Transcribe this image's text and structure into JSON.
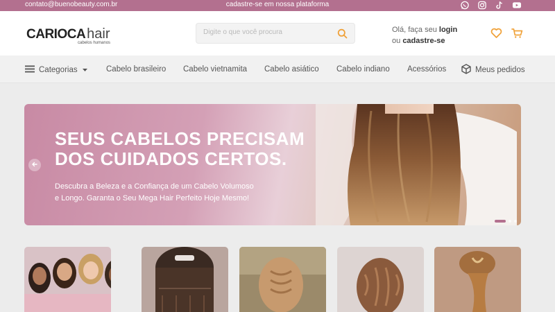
{
  "topbar": {
    "email": "contato@buenobeauty.com.br",
    "promo": "cadastre-se em nossa plataforma",
    "social": [
      "whatsapp-icon",
      "instagram-icon",
      "tiktok-icon",
      "youtube-icon"
    ]
  },
  "header": {
    "logo_main": "CARIOCA",
    "logo_sub": "hair",
    "logo_tagline": "cabelos humanos",
    "search_placeholder": "Digite o que você procura",
    "account_greeting": "Olá, faça seu",
    "account_login": "login",
    "account_or": "ou",
    "account_register": "cadastre-se"
  },
  "nav": {
    "categories": "Categorias",
    "items": [
      "Cabelo brasileiro",
      "Cabelo vietnamita",
      "Cabelo asiático",
      "Cabelo indiano",
      "Acessórios"
    ],
    "orders": "Meus pedidos"
  },
  "hero": {
    "title_line1": "SEUS CABELOS PRECISAM",
    "title_line2": "DOS CUIDADOS CERTOS.",
    "text_line1": "Descubra a Beleza e a Confiança de um Cabelo Volumoso",
    "text_line2": "e Longo. Garanta o Seu Mega Hair Perfeito Hoje Mesmo!",
    "slide_active": 1,
    "slide_count": 3
  },
  "colors": {
    "brand": "#b3708f",
    "accent": "#f0a23a"
  }
}
